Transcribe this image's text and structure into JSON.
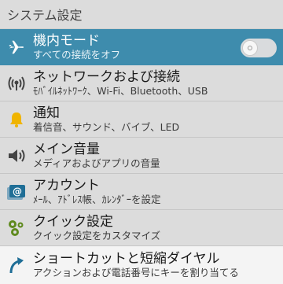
{
  "header": {
    "title": "システム設定"
  },
  "items": [
    {
      "title": "機内モード",
      "subtitle": "すべての接続をオフ",
      "icon": "airplane-icon"
    },
    {
      "title": "ネットワークおよび接続",
      "subtitle": "ﾓﾊﾞｲﾙﾈｯﾄﾜｰｸ、Wi-Fi、Bluetooth、USB",
      "icon": "network-icon"
    },
    {
      "title": "通知",
      "subtitle": "着信音、サウンド、バイブ、LED",
      "icon": "bell-icon"
    },
    {
      "title": "メイン音量",
      "subtitle": "メディアおよびアプリの音量",
      "icon": "speaker-icon"
    },
    {
      "title": "アカウント",
      "subtitle": "ﾒｰﾙ、ｱﾄﾞﾚｽ帳、ｶﾚﾝﾀﾞｰを設定",
      "icon": "account-icon"
    },
    {
      "title": "クイック設定",
      "subtitle": "クイック設定をカスタマイズ",
      "icon": "quick-settings-icon"
    },
    {
      "title": "ショートカットと短縮ダイヤル",
      "subtitle": "アクションおよび電話番号にキーを割り当てる",
      "icon": "shortcut-arrow-icon"
    }
  ],
  "toggle_airplane": {
    "state": "off"
  },
  "colors": {
    "highlight": "#3e8cad",
    "accent_icon": "#1f6e96",
    "bell": "#f0b400",
    "quick": "#5f8a1e"
  }
}
